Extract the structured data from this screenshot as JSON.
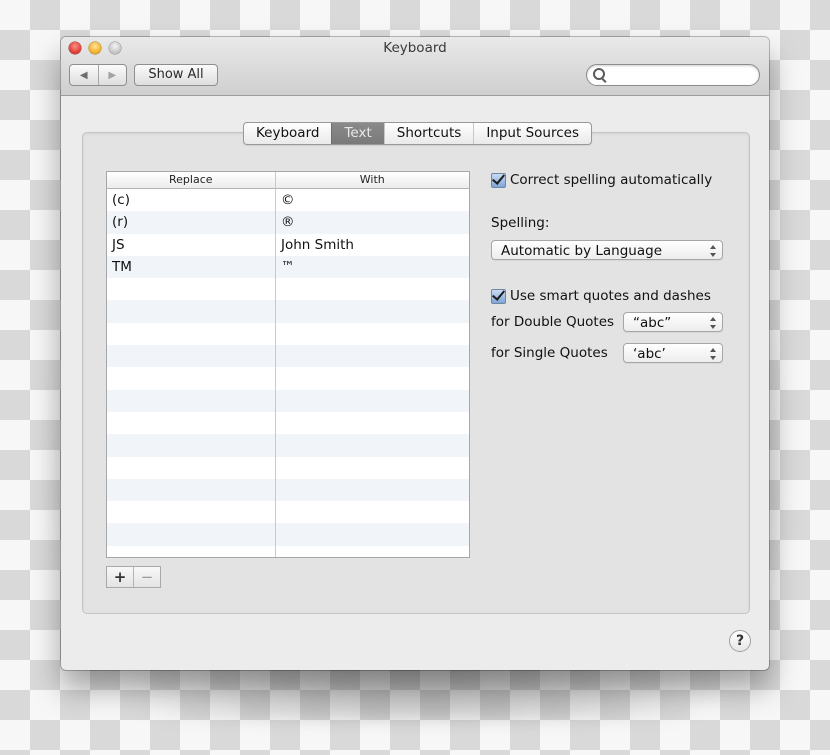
{
  "window": {
    "title": "Keyboard",
    "controls": [
      "close",
      "minimize",
      "zoom"
    ]
  },
  "toolbar": {
    "back_icon": "◀",
    "forward_icon": "▶",
    "show_all_label": "Show All",
    "search_placeholder": "",
    "search_value": ""
  },
  "tabs": [
    {
      "label": "Keyboard",
      "active": false
    },
    {
      "label": "Text",
      "active": true
    },
    {
      "label": "Shortcuts",
      "active": false
    },
    {
      "label": "Input Sources",
      "active": false
    }
  ],
  "table": {
    "headers": [
      "Replace",
      "With"
    ],
    "rows": [
      {
        "replace": "(c)",
        "with": "©"
      },
      {
        "replace": "(r)",
        "with": "®"
      },
      {
        "replace": "JS",
        "with": "John Smith"
      },
      {
        "replace": "TM",
        "with": "™"
      }
    ],
    "add_label": "+",
    "remove_label": "−"
  },
  "options": {
    "correct_spelling_label": "Correct spelling automatically",
    "correct_spelling_checked": true,
    "spelling_label": "Spelling:",
    "spelling_value": "Automatic by Language",
    "smart_quotes_label": "Use smart quotes and dashes",
    "smart_quotes_checked": true,
    "double_quotes_label": "for Double Quotes",
    "double_quotes_value": "“abc”",
    "single_quotes_label": "for Single Quotes",
    "single_quotes_value": "‘abc’"
  },
  "help_label": "?"
}
